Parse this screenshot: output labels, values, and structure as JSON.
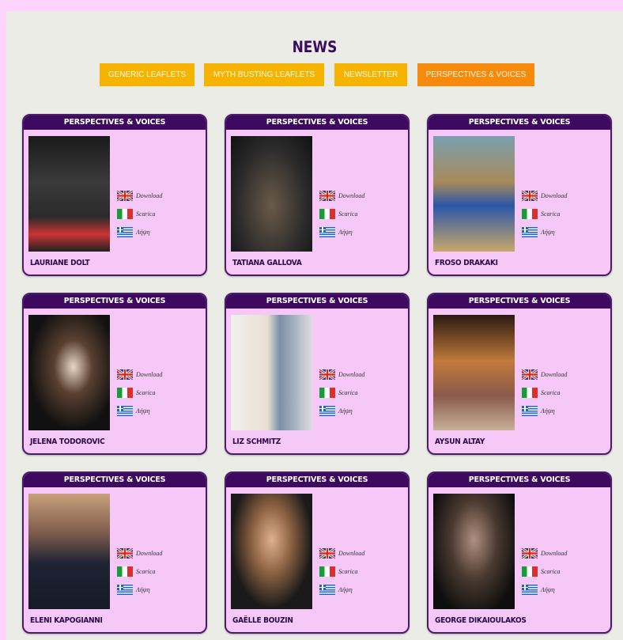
{
  "title": "NEWS",
  "tabs": [
    {
      "label": "GENERIC LEAFLETS",
      "active": false
    },
    {
      "label": "MYTH BUSTING LEAFLETS",
      "active": false
    },
    {
      "label": "NEWSLETTER",
      "active": false
    },
    {
      "label": "PERSPECTIVES & VOICES",
      "active": true
    }
  ],
  "cards": [
    {
      "header": "PERSPECTIVES & VOICES",
      "name": "LAURIANE DOLT",
      "links": [
        "Download",
        "Scarica",
        "Λήψη"
      ]
    },
    {
      "header": "PERSPECTIVES & VOICES",
      "name": "TATIANA GALLOVA",
      "links": [
        "Download",
        "Scarica",
        "Λήψη"
      ]
    },
    {
      "header": "PERSPECTIVES & VOICES",
      "name": "FROSO DRAKAKI",
      "links": [
        "Download",
        "Scarica",
        "Λήψη"
      ]
    },
    {
      "header": "PERSPECTIVES & VOICES",
      "name": "JELENA TODOROVIC",
      "links": [
        "Download",
        "Scarica",
        "Λήψη"
      ]
    },
    {
      "header": "PERSPECTIVES & VOICES",
      "name": "LIZ SCHMITZ",
      "links": [
        "Download",
        "Scarica",
        "Λήψη"
      ]
    },
    {
      "header": "PERSPECTIVES & VOICES",
      "name": "AYSUN ALTAY",
      "links": [
        "Download",
        "Scarica",
        "Λήψη"
      ]
    },
    {
      "header": "PERSPECTIVES & VOICES",
      "name": "ELENI KAPOGIANNI",
      "links": [
        "Download",
        "Scarica",
        "Λήψη"
      ]
    },
    {
      "header": "PERSPECTIVES & VOICES",
      "name": "GAËLLE BOUZIN",
      "links": [
        "Download",
        "Scarica",
        "Λήψη"
      ]
    },
    {
      "header": "PERSPECTIVES & VOICES",
      "name": "GEORGE DIKAIOULAKOS",
      "links": [
        "Download",
        "Scarica",
        "Λήψη"
      ]
    }
  ],
  "colors": {
    "page_bg": "#fbd3fb",
    "panel_bg": "#ebece6",
    "card_bg": "#f5c8f8",
    "card_header": "#3d0a60",
    "tab": "#f6b400",
    "tab_active": "#f58a0b",
    "title": "#3a0c5e"
  }
}
